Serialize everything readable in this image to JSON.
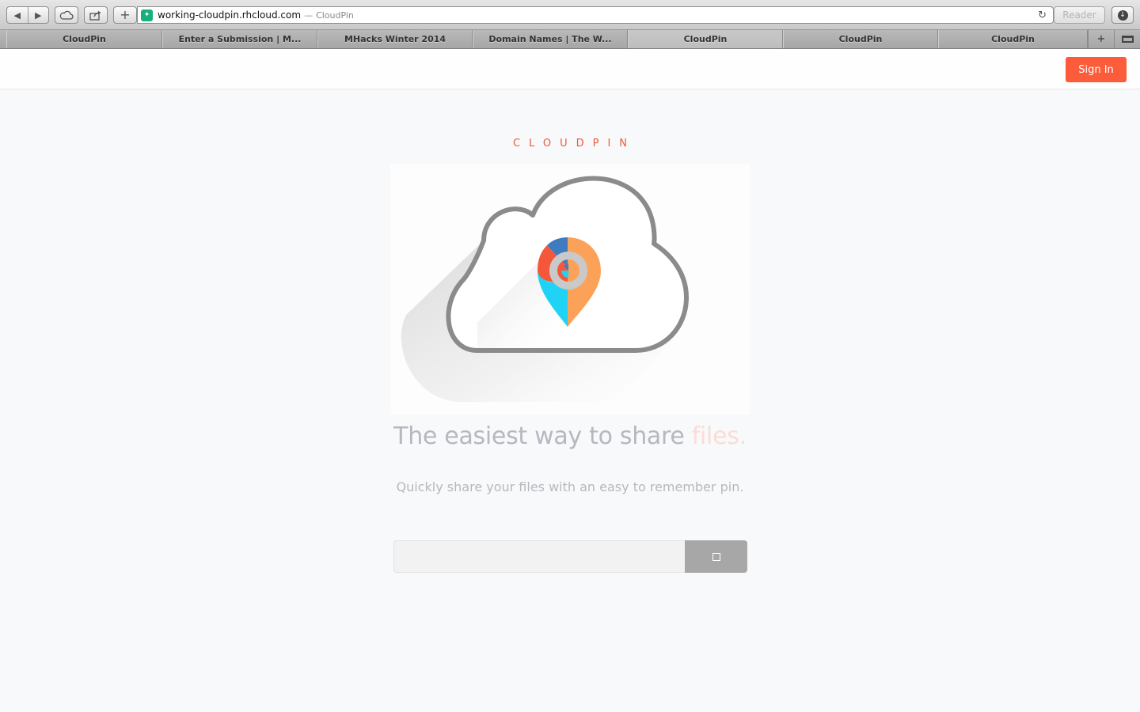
{
  "browser": {
    "address": {
      "host": "working-cloudpin.rhcloud.com",
      "separator": "—",
      "page_title": "CloudPin"
    },
    "reader_label": "Reader",
    "tabs": [
      {
        "label": "CloudPin"
      },
      {
        "label": "Enter a Submission | M..."
      },
      {
        "label": "MHacks Winter 2014"
      },
      {
        "label": "Domain Names | The W..."
      },
      {
        "label": "CloudPin"
      },
      {
        "label": "CloudPin"
      },
      {
        "label": "CloudPin"
      }
    ],
    "icons": {
      "back": "back-arrow-icon",
      "forward": "forward-arrow-icon",
      "icloud": "cloud-icon",
      "share": "share-icon",
      "add": "plus-icon",
      "reload": "reload-icon",
      "downloads": "download-icon"
    }
  },
  "header": {
    "signin_label": "Sign In",
    "accent_color": "#fc5c3a"
  },
  "hero": {
    "brand": "CLOUDPIN",
    "tagline_main": "The easiest way to share ",
    "tagline_accent": "files.",
    "subline": "Quickly share your files with an easy to remember pin.",
    "pin_input_value": "",
    "pin_colors": {
      "orange": "#fca158",
      "red": "#f5573a",
      "blue": "#3e7bbf",
      "cyan": "#1ed3f5",
      "cloud_outline": "#8b8b8b"
    }
  }
}
